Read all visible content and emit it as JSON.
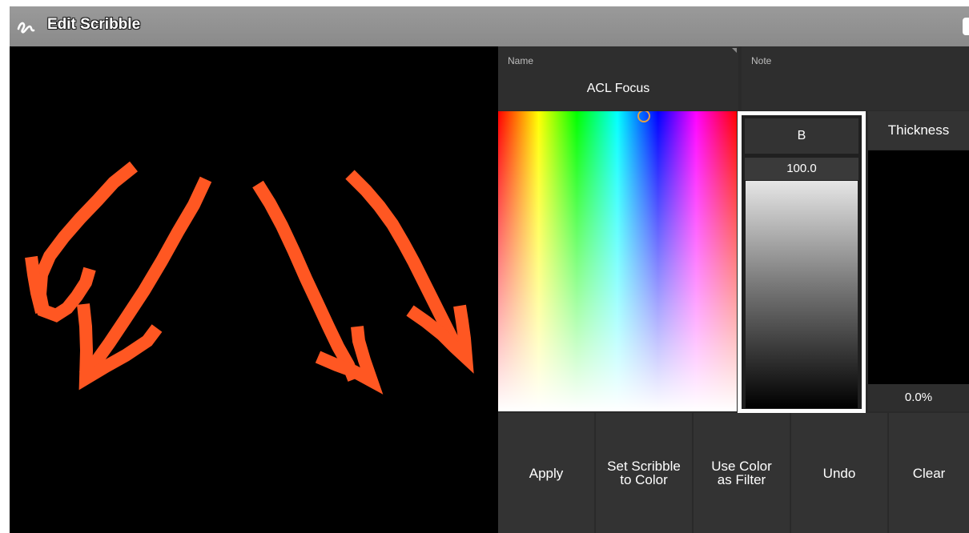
{
  "window": {
    "title": "Edit Scribble",
    "scribble_color": "#ff5722"
  },
  "fields": {
    "name": {
      "label": "Name",
      "value": "ACL Focus"
    },
    "note": {
      "label": "Note",
      "value": ""
    }
  },
  "color_picker": {
    "channel_label": "B",
    "channel_value": "100.0",
    "thickness_label": "Thickness",
    "thickness_value": "0.0%"
  },
  "buttons": {
    "apply": "Apply",
    "set_scribble": "Set Scribble\nto Color",
    "use_color": "Use Color\nas Filter",
    "undo": "Undo",
    "clear": "Clear"
  }
}
